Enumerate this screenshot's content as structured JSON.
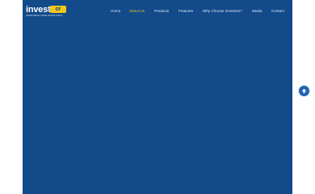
{
  "brand": {
    "word": "invest",
    "badge": "or",
    "tagline": "INVESTMENT MADE EFFORTLESS"
  },
  "nav": {
    "items": [
      {
        "label": "Home",
        "active": false
      },
      {
        "label": "About Us",
        "active": true
      },
      {
        "label": "Products",
        "active": false
      },
      {
        "label": "Features",
        "active": false
      },
      {
        "label": "Why Choose Investors?",
        "active": false
      },
      {
        "label": "Media",
        "active": false
      },
      {
        "label": "Contact",
        "active": false
      }
    ]
  },
  "colors": {
    "frame_background": "#124a8a",
    "accent": "#f2c916",
    "page_background": "#ffffff"
  },
  "icons": {
    "scroll_top": "arrow-up-icon"
  }
}
